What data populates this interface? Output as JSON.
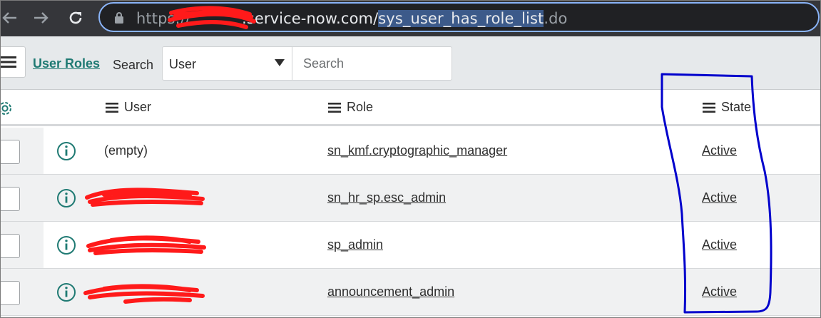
{
  "browser": {
    "url_scheme": "https://",
    "url_domain": ".service-now.com/",
    "url_selected": "sys_user_has_role_list",
    "url_tail": ".do"
  },
  "header": {
    "list_title": "User Roles",
    "search_label": "Search",
    "search_field": "User",
    "search_placeholder": "Search"
  },
  "columns": {
    "user": "User",
    "role": "Role",
    "state": "State"
  },
  "rows": [
    {
      "user": "(empty)",
      "role": "sn_kmf.cryptographic_manager",
      "state": "Active"
    },
    {
      "user": "",
      "role": "sn_hr_sp.esc_admin",
      "state": "Active"
    },
    {
      "user": "",
      "role": "sp_admin",
      "state": "Active"
    },
    {
      "user": "",
      "role": "announcement_admin",
      "state": "Active"
    }
  ],
  "colors": {
    "accent": "#1f7a73",
    "annotation": "#0000cc",
    "redaction": "#ff1a1a"
  }
}
